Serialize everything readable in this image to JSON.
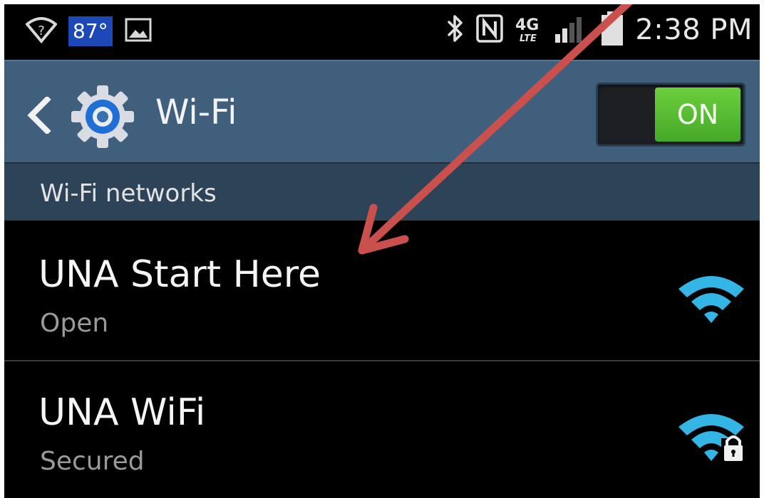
{
  "status_bar": {
    "temperature": "87°",
    "time": "2:38 PM",
    "network_type": "4G LTE"
  },
  "action_bar": {
    "title": "Wi-Fi",
    "toggle_label": "ON"
  },
  "section": {
    "label": "Wi-Fi networks"
  },
  "networks": [
    {
      "name": "UNA Start Here",
      "status": "Open",
      "icon": "wifi-signal-icon"
    },
    {
      "name": "UNA WiFi",
      "status": "Secured",
      "icon": "wifi-secured-icon"
    }
  ],
  "colors": {
    "action_bar": "#3f5f7c",
    "section_header": "#2d4357",
    "toggle_on": "#5ec034",
    "wifi_signal": "#33b5e5",
    "annotation_arrow": "#c9504c"
  }
}
